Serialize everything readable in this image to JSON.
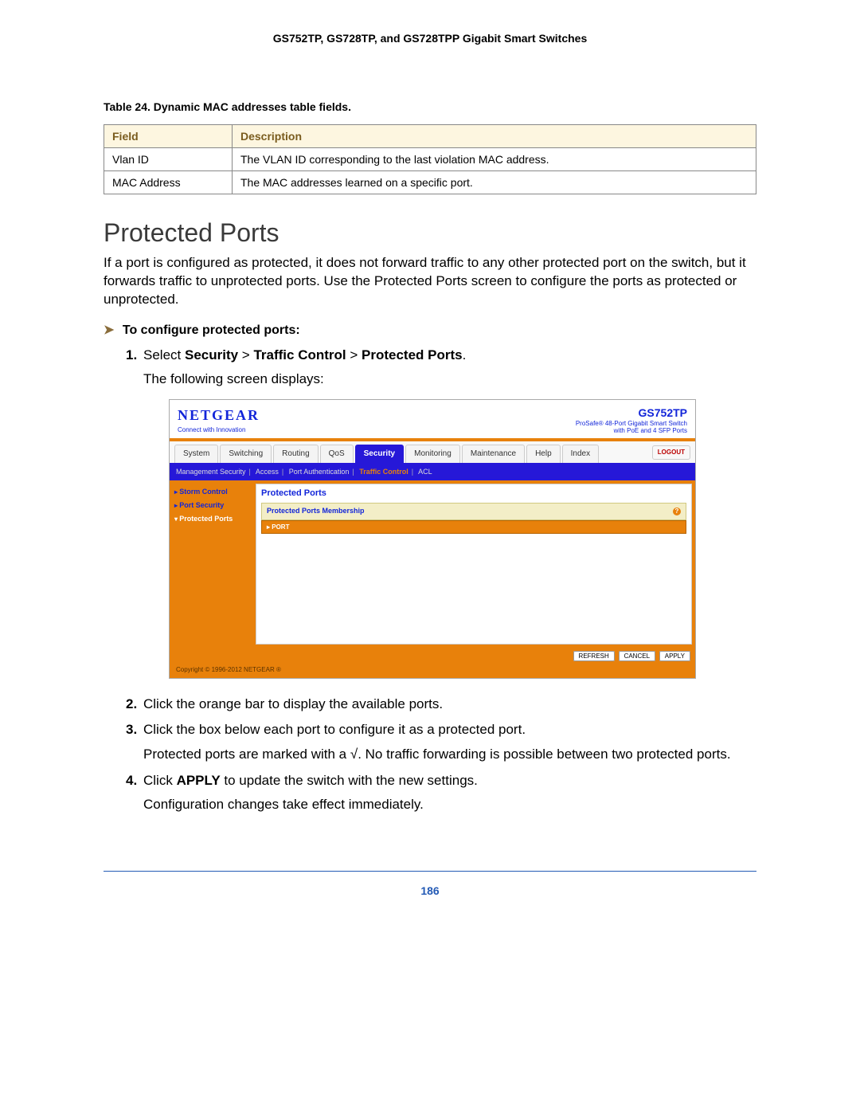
{
  "doc_header": "GS752TP, GS728TP, and GS728TPP Gigabit Smart Switches",
  "table_caption": "Table 24.  Dynamic MAC addresses table fields.",
  "table": {
    "headers": {
      "field": "Field",
      "description": "Description"
    },
    "rows": [
      {
        "field": "Vlan ID",
        "description": "The VLAN ID corresponding to the last violation MAC address."
      },
      {
        "field": "MAC Address",
        "description": "The MAC addresses learned on a specific port."
      }
    ]
  },
  "section_title": "Protected Ports",
  "intro_paragraph": "If a port is configured as protected, it does not forward traffic to any other protected port on the switch, but it forwards traffic to unprotected ports. Use the Protected Ports screen to configure the ports as protected or unprotected.",
  "procedure_heading": "To configure protected ports:",
  "steps": {
    "s1": {
      "num": "1.",
      "pre": "Select ",
      "nav1": "Security",
      "sep1": " > ",
      "nav2": "Traffic Control",
      "sep2": " > ",
      "nav3": "Protected Ports",
      "post": ".",
      "line2": "The following screen displays:"
    },
    "s2": {
      "num": "2.",
      "text": "Click the orange bar to display the available ports."
    },
    "s3": {
      "num": "3.",
      "text": "Click the box below each port to configure it as a protected port.",
      "line2a": "Protected ports are marked with a ",
      "check": "√",
      "line2b": ". No traffic forwarding is possible between two protected ports."
    },
    "s4": {
      "num": "4.",
      "pre": "Click ",
      "btn": "APPLY",
      "post": " to update the switch with the new settings.",
      "line2": "Configuration changes take effect immediately."
    }
  },
  "screenshot": {
    "brand": "NETGEAR",
    "brand_sub": "Connect with Innovation",
    "model": "GS752TP",
    "model_desc1": "ProSafe® 48-Port Gigabit Smart Switch",
    "model_desc2": "with PoE and 4 SFP Ports",
    "tabs": [
      "System",
      "Switching",
      "Routing",
      "QoS",
      "Security",
      "Monitoring",
      "Maintenance",
      "Help",
      "Index"
    ],
    "active_tab_index": 4,
    "logout": "LOGOUT",
    "subnav": [
      "Management Security",
      "Access",
      "Port Authentication",
      "Traffic Control",
      "ACL"
    ],
    "subnav_active_index": 3,
    "sidebar": [
      "Storm Control",
      "Port Security",
      "Protected Ports"
    ],
    "sidebar_selected_index": 2,
    "main_title": "Protected Ports",
    "panel_head": "Protected Ports Membership",
    "port_bar": "PORT",
    "buttons": {
      "refresh": "REFRESH",
      "cancel": "CANCEL",
      "apply": "APPLY"
    },
    "copyright": "Copyright © 1996-2012 NETGEAR ®"
  },
  "page_number": "186"
}
